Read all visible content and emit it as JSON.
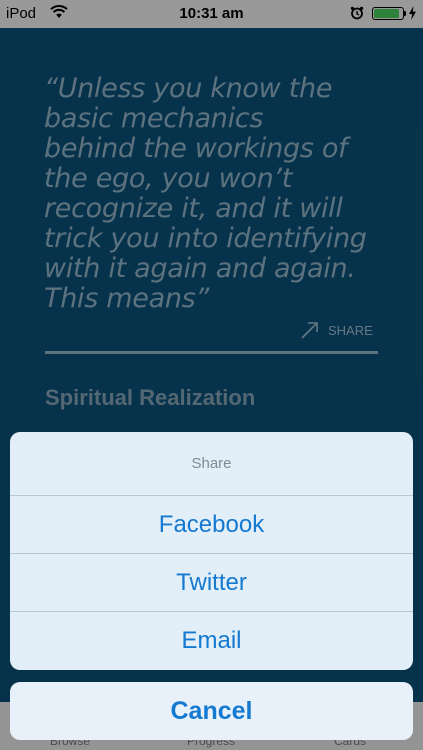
{
  "status_bar": {
    "carrier": "iPod",
    "time": "10:31 am",
    "battery_level_percent": 90,
    "icons": [
      "wifi-icon",
      "alarm-icon",
      "battery-icon",
      "charging-icon"
    ]
  },
  "page": {
    "quote": "“Unless you know the\nbasic mechanics\nbehind the workings of\nthe ego, you won’t\nrecognize it, and it will\ntrick you into identifying\nwith it again and again.\nThis means”",
    "share_label": "SHARE",
    "section_title": "Spiritual Realization"
  },
  "tab_bar": {
    "items": [
      {
        "label": "Browse"
      },
      {
        "label": "Progress"
      },
      {
        "label": "Cards"
      }
    ]
  },
  "action_sheet": {
    "title": "Share",
    "options": [
      {
        "label": "Facebook"
      },
      {
        "label": "Twitter"
      },
      {
        "label": "Email"
      }
    ],
    "cancel_label": "Cancel"
  },
  "colors": {
    "background": "#0b557d",
    "sheet_background": "#e3eff8",
    "action_text": "#1479d1",
    "quote_text": "#9bbfd4"
  }
}
